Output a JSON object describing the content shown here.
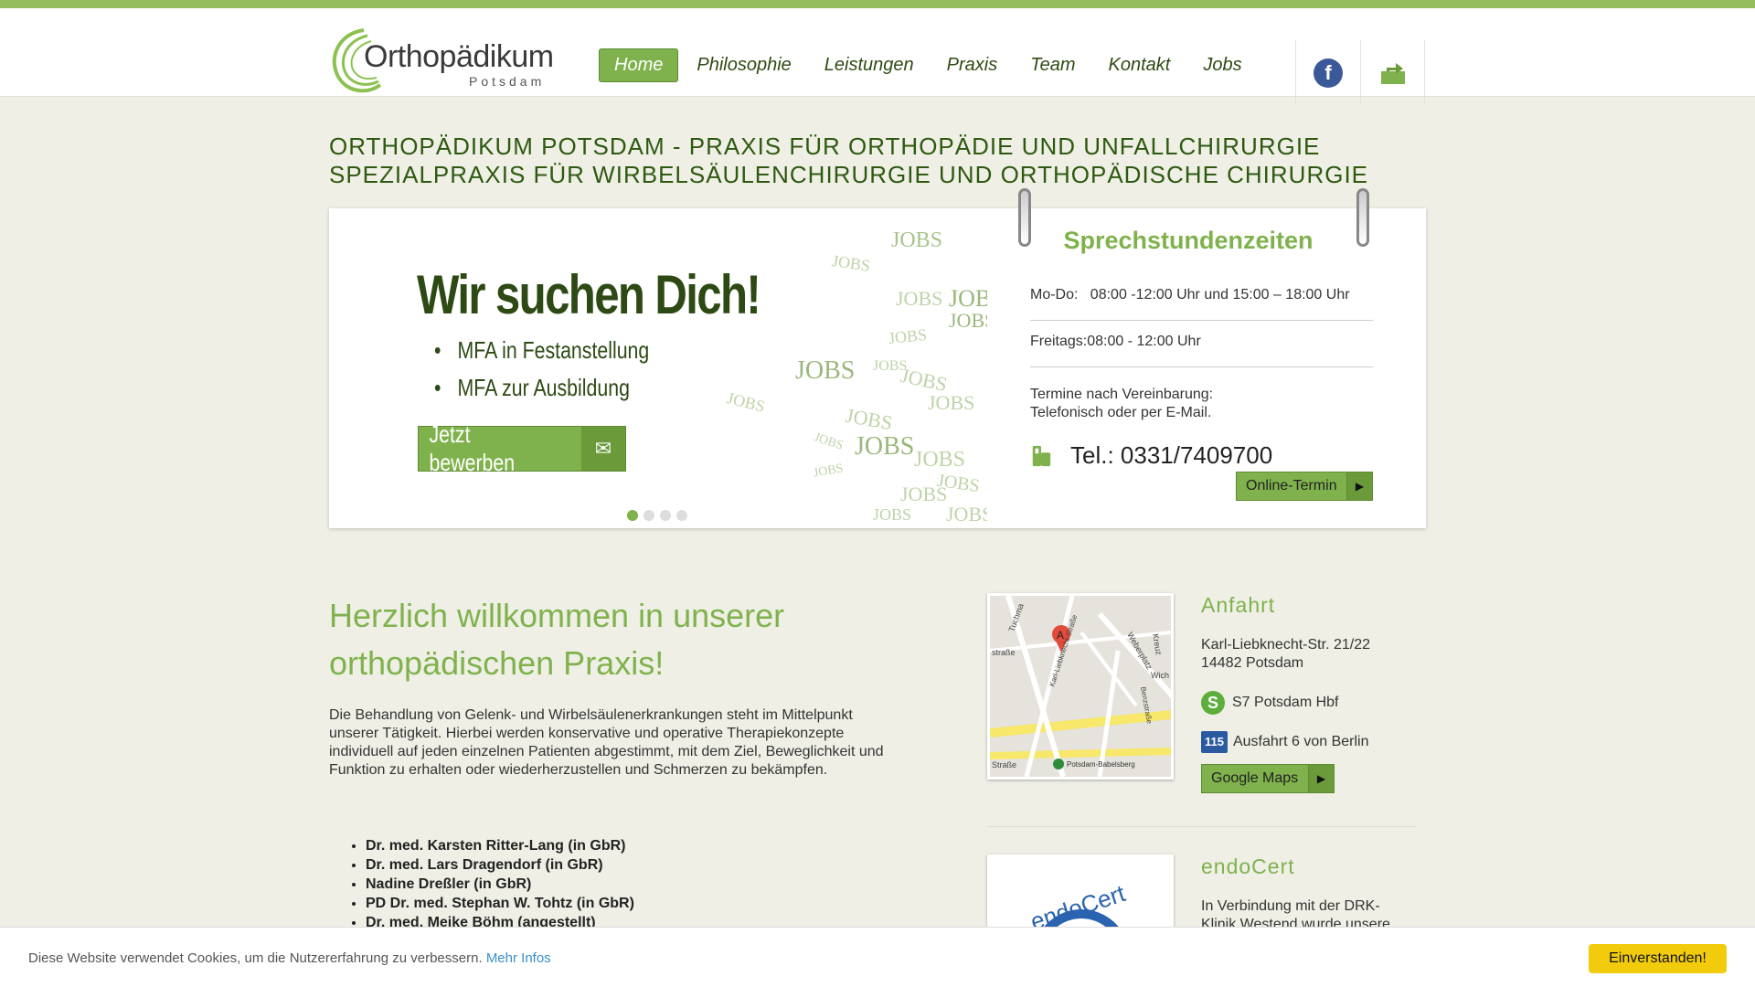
{
  "header": {
    "logo_word": "Orthopädikum",
    "logo_sub": "Potsdam",
    "nav": [
      "Home",
      "Philosophie",
      "Leistungen",
      "Praxis",
      "Team",
      "Kontakt",
      "Jobs"
    ],
    "facebook_glyph": "f"
  },
  "headline": {
    "line1": "Orthopädikum Potsdam - Praxis für Orthopädie und Unfallchirurgie",
    "line2": "Spezialpraxis für Wirbelsäulenchirurgie und orthopädische Chirurgie"
  },
  "slider": {
    "title": "Wir suchen Dich!",
    "items": [
      "MFA in Festanstellung",
      "MFA zur Ausbildung"
    ],
    "button": "Jetzt bewerben",
    "watermark_word": "JOBS",
    "active_dot": 0,
    "dot_count": 4
  },
  "hours": {
    "title": "Sprechstundenzeiten",
    "mo_do_label": "Mo-Do:",
    "mo_do_value": "08:00 -12:00 Uhr und 15:00 – 18:00 Uhr",
    "fr_label": "Freitags:",
    "fr_value": "08:00 - 12:00 Uhr",
    "termine1": "Termine nach Vereinbarung:",
    "termine2": "Telefonisch oder per E-Mail.",
    "tel": "Tel.: 0331/7409700",
    "online_button": "Online-Termin"
  },
  "main": {
    "welcome": "Herzlich willkommen in unserer orthopädischen Praxis!",
    "intro": "Die Behandlung von Gelenk- und Wirbelsäulenerkrankungen steht im Mittelpunkt unserer Tätigkeit. Hierbei  werden konservative und operative Therapiekonzepte individuell auf jeden einzelnen Patienten abgestimmt, mit dem Ziel, Beweglichkeit und Funktion zu erhalten oder wiederherzustellen und Schmerzen zu bekämpfen.",
    "doctors": [
      "Dr. med. Karsten Ritter-Lang (in GbR)",
      "Dr. med. Lars Dragendorf (in GbR)",
      "Nadine Dreßler (in GbR)",
      "PD Dr. med. Stephan W. Tohtz (in GbR)",
      "Dr. med. Meike Böhm (angestellt)"
    ]
  },
  "anfahrt": {
    "title": "Anfahrt",
    "street": "Karl-Liebknecht-Str. 21/22",
    "city": "14482 Potsdam",
    "sbahn_glyph": "S",
    "sbahn": "S7 Potsdam Hbf",
    "highway_badge": "115",
    "highway": "Ausfahrt 6 von Berlin",
    "maps_button": "Google Maps",
    "map_marker": "A",
    "map_streets": [
      "Tuchma",
      "Karl-Liebknecht-Straße",
      "Weberplatz",
      "Kreuz",
      "Wich",
      "straße",
      "Benzstraße",
      "Straße",
      "Potsdam-Babelsberg"
    ]
  },
  "endocert": {
    "title": "endoCert",
    "text": "In Verbindung mit der DRK-Klinik Westend wurde unsere",
    "logo_text": "endoCert"
  },
  "cookie": {
    "text": "Diese Website verwendet Cookies, um die Nutzererfahrung zu verbessern.",
    "link": "Mehr Infos",
    "button": "Einverstanden!"
  }
}
